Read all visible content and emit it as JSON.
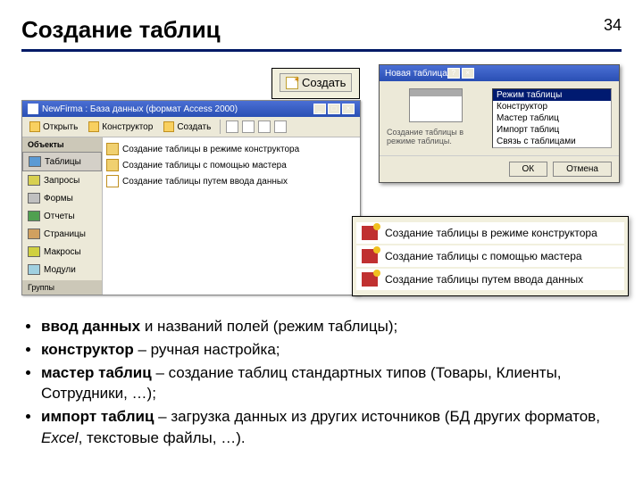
{
  "slide": {
    "title": "Создание таблиц",
    "number": "34"
  },
  "create_button": {
    "label": "Создать"
  },
  "db_window": {
    "title": "NewFirma : База данных (формат Access 2000)",
    "toolbar": {
      "open": "Открыть",
      "design": "Конструктор",
      "create": "Создать"
    },
    "sidebar": {
      "heading": "Объекты",
      "items": [
        {
          "label": "Таблицы"
        },
        {
          "label": "Запросы"
        },
        {
          "label": "Формы"
        },
        {
          "label": "Отчеты"
        },
        {
          "label": "Страницы"
        },
        {
          "label": "Макросы"
        },
        {
          "label": "Модули"
        }
      ],
      "groups": "Группы"
    },
    "main_items": [
      "Создание таблицы в режиме конструктора",
      "Создание таблицы с помощью мастера",
      "Создание таблицы путем ввода данных"
    ]
  },
  "nt_dialog": {
    "title": "Новая таблица",
    "preview_text": "Создание таблицы в режиме таблицы.",
    "list": [
      "Режим таблицы",
      "Конструктор",
      "Мастер таблиц",
      "Импорт таблиц",
      "Связь с таблицами"
    ],
    "ok": "ОК",
    "cancel": "Отмена"
  },
  "zoom": [
    "Создание таблицы в режиме конструктора",
    "Создание таблицы с помощью мастера",
    "Создание таблицы путем ввода данных"
  ],
  "bullets": {
    "b1a": "ввод данных",
    "b1b": " и названий полей (режим таблицы);",
    "b2a": "конструктор",
    "b2b": " – ручная настройка;",
    "b3a": "мастер таблиц",
    "b3b": " – создание таблиц стандартных типов (Товары, Клиенты, Сотрудники, …);",
    "b4a": "импорт таблиц",
    "b4b": " – загрузка данных из других источников (БД других форматов, ",
    "b4c": "Excel",
    "b4d": ", текстовые файлы, …)."
  }
}
